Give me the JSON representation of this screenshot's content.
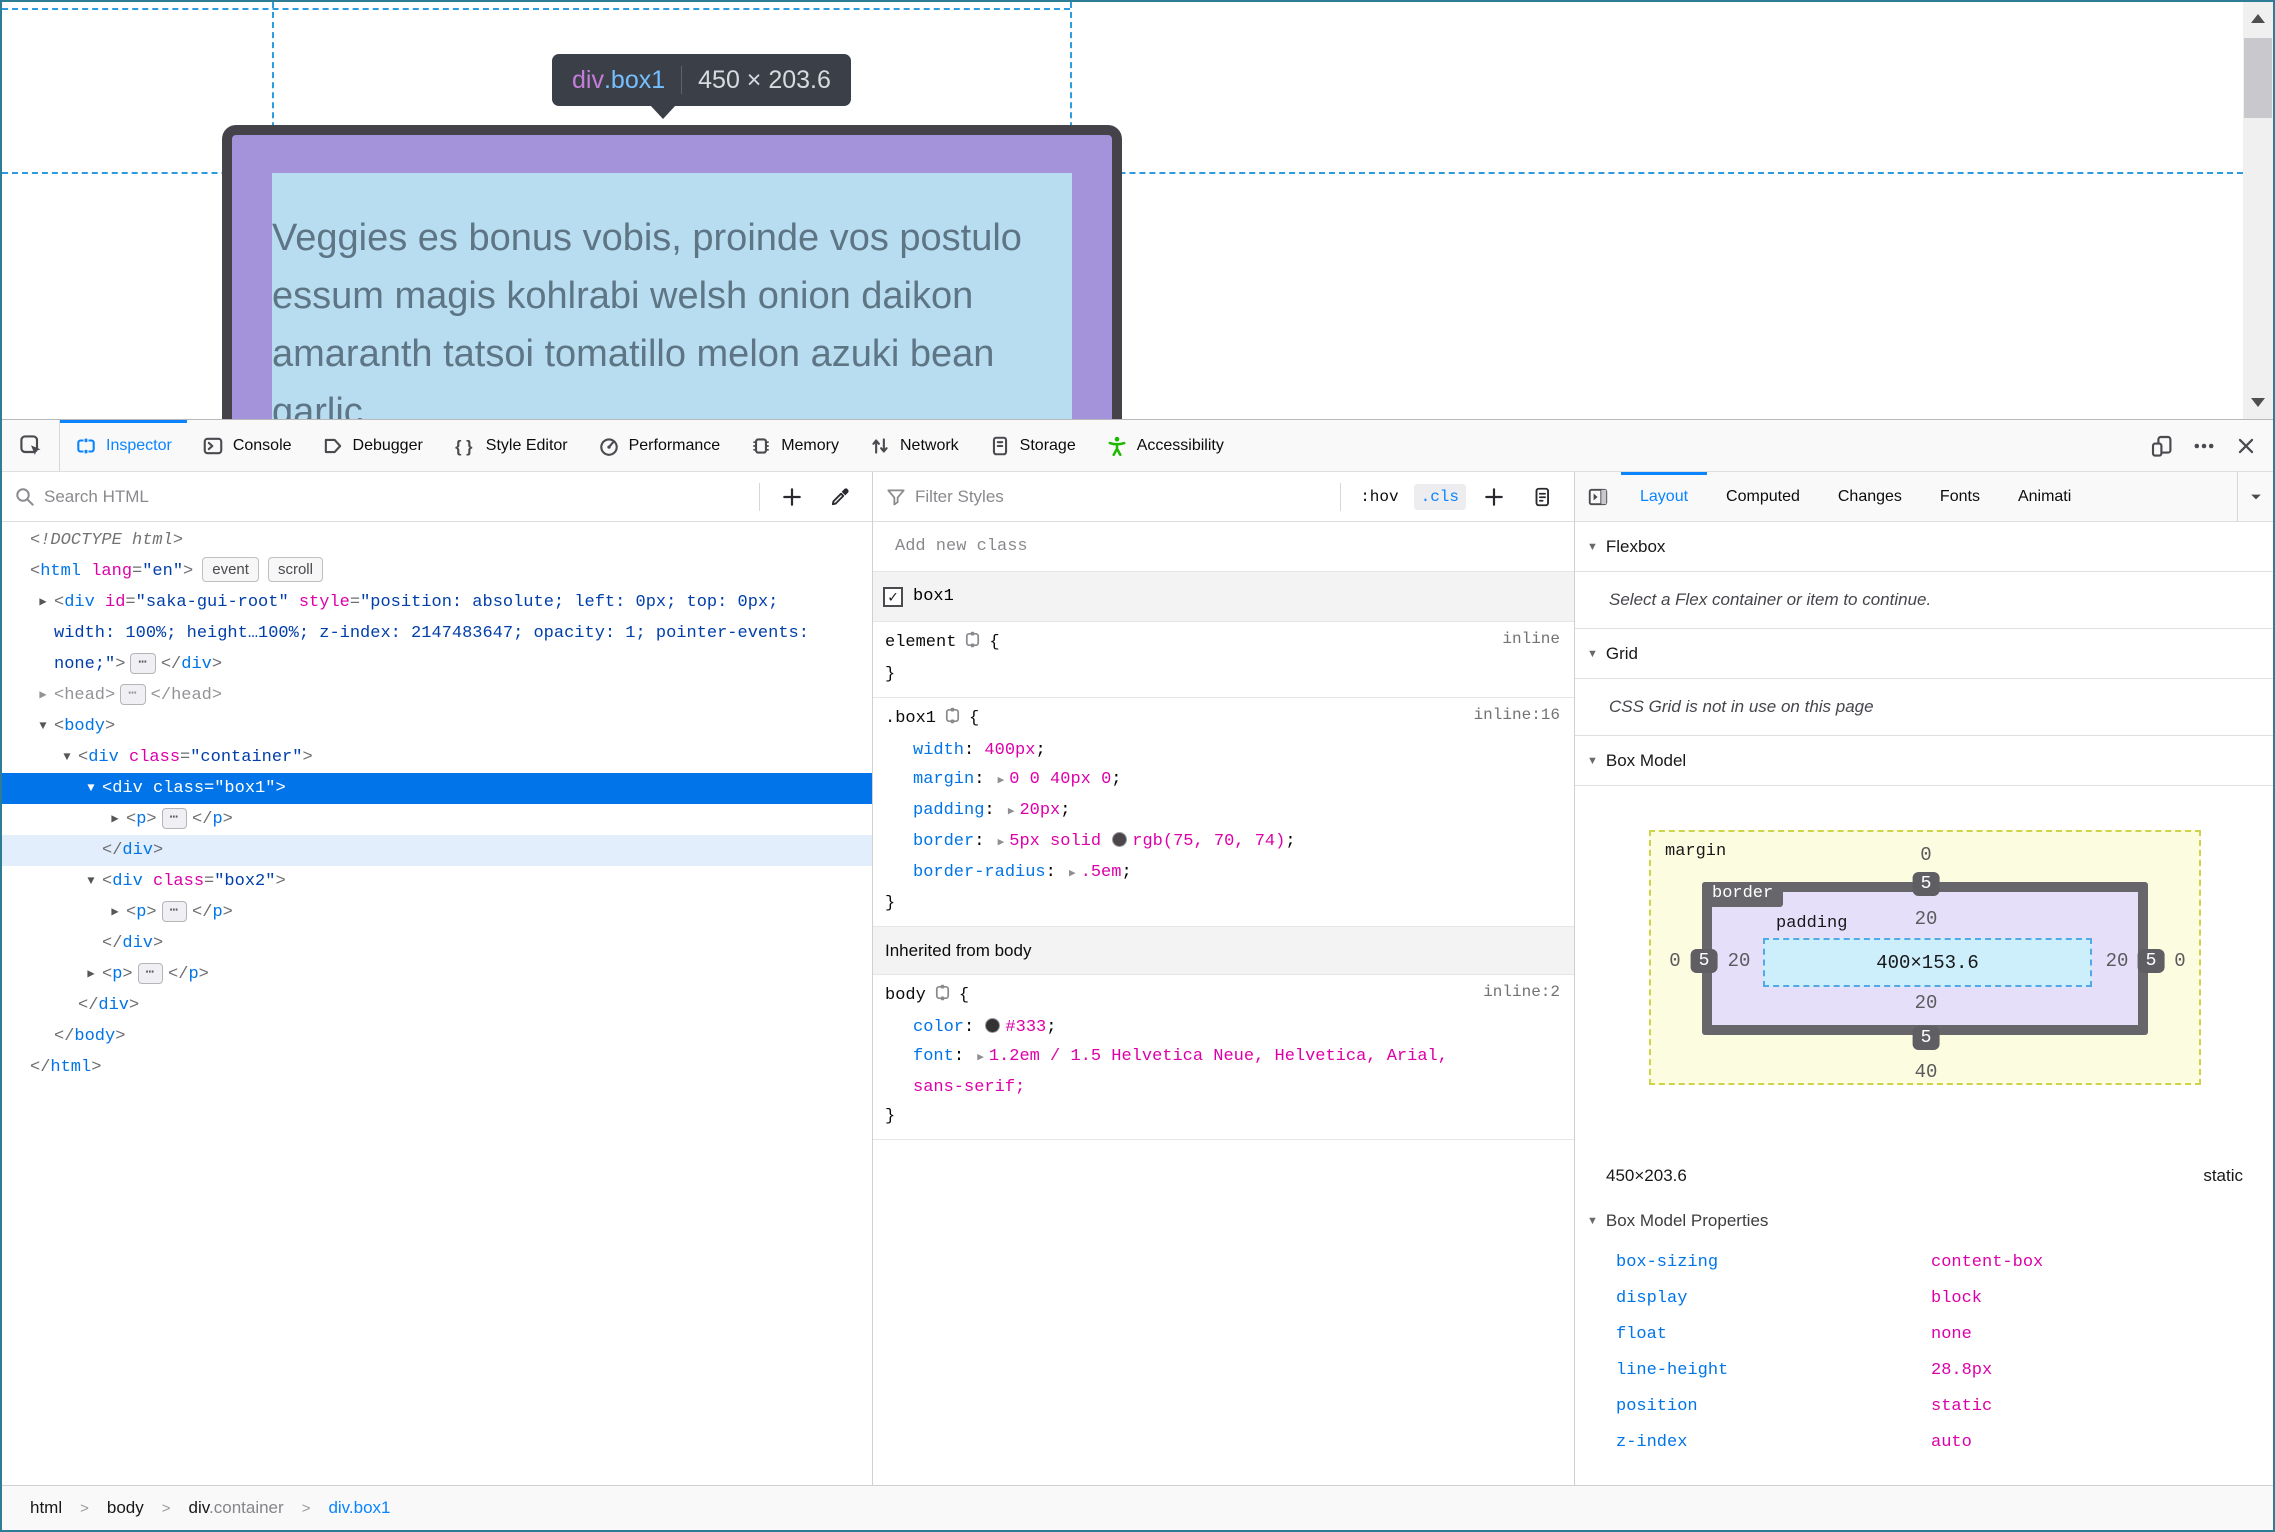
{
  "colors": {
    "accent": "#0a84ff",
    "tag_blue": "#0074e8",
    "attr_magenta": "#dd00a9",
    "value_navy": "#003eaa",
    "selection": "#0074e8",
    "a11y_green": "#1cb900",
    "border_swatch": "#4a464a",
    "color_swatch": "#333333"
  },
  "page": {
    "tooltip": {
      "tag": "div",
      "class": ".box1",
      "dims": "450 × 203.6"
    },
    "content_text": "Veggies es bonus vobis, proinde vos postulo essum magis kohlrabi welsh onion daikon amaranth tatsoi tomatillo melon azuki bean garlic"
  },
  "toolbox": {
    "tabs": [
      {
        "id": "inspector",
        "label": "Inspector",
        "icon": "inspector-icon",
        "active": true
      },
      {
        "id": "console",
        "label": "Console",
        "icon": "console-icon"
      },
      {
        "id": "debugger",
        "label": "Debugger",
        "icon": "debugger-icon"
      },
      {
        "id": "styleeditor",
        "label": "Style Editor",
        "icon": "style-editor-icon"
      },
      {
        "id": "performance",
        "label": "Performance",
        "icon": "performance-icon"
      },
      {
        "id": "memory",
        "label": "Memory",
        "icon": "memory-icon"
      },
      {
        "id": "network",
        "label": "Network",
        "icon": "network-icon"
      },
      {
        "id": "storage",
        "label": "Storage",
        "icon": "storage-icon"
      },
      {
        "id": "accessibility",
        "label": "Accessibility",
        "icon": "accessibility-icon"
      }
    ]
  },
  "markup": {
    "search_placeholder": "Search HTML",
    "lines": [
      {
        "ind": 0,
        "tokens": [
          [
            "doctype",
            "<!DOCTYPE html>"
          ]
        ]
      },
      {
        "ind": 0,
        "tokens": [
          [
            "p",
            "<"
          ],
          [
            "t",
            "html"
          ],
          [
            "a",
            " lang"
          ],
          [
            "p",
            "="
          ],
          [
            "v",
            "\"en\""
          ],
          [
            "p",
            ">"
          ]
        ],
        "badges": [
          "event",
          "scroll"
        ]
      },
      {
        "ind": 1,
        "arrow": "right",
        "wrap": true,
        "tokens": [
          [
            "p",
            "<"
          ],
          [
            "t",
            "div"
          ],
          [
            "a",
            " id"
          ],
          [
            "p",
            "="
          ],
          [
            "v",
            "\"saka-gui-root\""
          ],
          [
            "a",
            " style"
          ],
          [
            "p",
            "="
          ],
          [
            "v",
            "\"position: absolute; left: 0px; top: 0px; width: 100%; height…100%; z-index: 2147483647; opacity: 1; pointer-events: none;\""
          ],
          [
            "p",
            ">"
          ],
          [
            "e",
            ""
          ],
          [
            "p",
            "</"
          ],
          [
            "t",
            "div"
          ],
          [
            "p",
            ">"
          ]
        ]
      },
      {
        "ind": 1,
        "arrow": "right",
        "cls": "dim",
        "tokens": [
          [
            "p",
            "<"
          ],
          [
            "t",
            "head"
          ],
          [
            "p",
            ">"
          ],
          [
            "e",
            ""
          ],
          [
            "p",
            "</"
          ],
          [
            "t",
            "head"
          ],
          [
            "p",
            ">"
          ]
        ]
      },
      {
        "ind": 1,
        "arrow": "down",
        "tokens": [
          [
            "p",
            "<"
          ],
          [
            "t",
            "body"
          ],
          [
            "p",
            ">"
          ]
        ]
      },
      {
        "ind": 2,
        "arrow": "down",
        "tokens": [
          [
            "p",
            "<"
          ],
          [
            "t",
            "div"
          ],
          [
            "a",
            " class"
          ],
          [
            "p",
            "="
          ],
          [
            "v",
            "\"container\""
          ],
          [
            "p",
            ">"
          ]
        ]
      },
      {
        "ind": 3,
        "arrow": "down",
        "cls": "sel",
        "tokens": [
          [
            "p",
            "<"
          ],
          [
            "t",
            "div"
          ],
          [
            "a",
            " class"
          ],
          [
            "p",
            "="
          ],
          [
            "v",
            "\"box1\""
          ],
          [
            "p",
            ">"
          ]
        ]
      },
      {
        "ind": 4,
        "arrow": "right",
        "tokens": [
          [
            "p",
            "<"
          ],
          [
            "t",
            "p"
          ],
          [
            "p",
            ">"
          ],
          [
            "e",
            ""
          ],
          [
            "p",
            "</"
          ],
          [
            "t",
            "p"
          ],
          [
            "p",
            ">"
          ]
        ]
      },
      {
        "ind": 3,
        "cls": "tint",
        "tokens": [
          [
            "p",
            "</"
          ],
          [
            "t",
            "div"
          ],
          [
            "p",
            ">"
          ]
        ]
      },
      {
        "ind": 3,
        "arrow": "down",
        "tokens": [
          [
            "p",
            "<"
          ],
          [
            "t",
            "div"
          ],
          [
            "a",
            " class"
          ],
          [
            "p",
            "="
          ],
          [
            "v",
            "\"box2\""
          ],
          [
            "p",
            ">"
          ]
        ]
      },
      {
        "ind": 4,
        "arrow": "right",
        "tokens": [
          [
            "p",
            "<"
          ],
          [
            "t",
            "p"
          ],
          [
            "p",
            ">"
          ],
          [
            "e",
            ""
          ],
          [
            "p",
            "</"
          ],
          [
            "t",
            "p"
          ],
          [
            "p",
            ">"
          ]
        ]
      },
      {
        "ind": 3,
        "tokens": [
          [
            "p",
            "</"
          ],
          [
            "t",
            "div"
          ],
          [
            "p",
            ">"
          ]
        ]
      },
      {
        "ind": 3,
        "arrow": "right",
        "tokens": [
          [
            "p",
            "<"
          ],
          [
            "t",
            "p"
          ],
          [
            "p",
            ">"
          ],
          [
            "e",
            ""
          ],
          [
            "p",
            "</"
          ],
          [
            "t",
            "p"
          ],
          [
            "p",
            ">"
          ]
        ]
      },
      {
        "ind": 2,
        "tokens": [
          [
            "p",
            "</"
          ],
          [
            "t",
            "div"
          ],
          [
            "p",
            ">"
          ]
        ]
      },
      {
        "ind": 1,
        "tokens": [
          [
            "p",
            "</"
          ],
          [
            "t",
            "body"
          ],
          [
            "p",
            ">"
          ]
        ]
      },
      {
        "ind": 0,
        "tokens": [
          [
            "p",
            "</"
          ],
          [
            "t",
            "html"
          ],
          [
            "p",
            ">"
          ]
        ]
      }
    ]
  },
  "rules": {
    "filter_placeholder": "Filter Styles",
    "pseudo_hover": ":hov",
    "pseudo_class": ".cls",
    "add_class_placeholder": "Add new class",
    "class_toggle_label": "box1",
    "element_rule": {
      "selector": "element",
      "link": "inline"
    },
    "box1_rule": {
      "selector": ".box1",
      "link": "inline:16",
      "decls": [
        {
          "n": "width",
          "v": [
            [
              "t",
              "400px"
            ]
          ]
        },
        {
          "n": "margin",
          "v": [
            [
              "x",
              ""
            ],
            [
              "t",
              "0 0 40px 0"
            ]
          ]
        },
        {
          "n": "padding",
          "v": [
            [
              "x",
              ""
            ],
            [
              "t",
              "20px"
            ]
          ]
        },
        {
          "n": "border",
          "v": [
            [
              "x",
              ""
            ],
            [
              "t",
              "5px solid "
            ],
            [
              "sw",
              "#4a464a"
            ],
            [
              "t",
              "rgb(75, 70, 74)"
            ]
          ]
        },
        {
          "n": "border-radius",
          "v": [
            [
              "x",
              ""
            ],
            [
              "t",
              ".5em"
            ]
          ]
        }
      ]
    },
    "inherited_label": "Inherited from body",
    "body_rule": {
      "selector": "body",
      "link": "inline:2",
      "decls": [
        {
          "n": "color",
          "v": [
            [
              "sw",
              "#333333"
            ],
            [
              "t",
              "#333"
            ]
          ]
        },
        {
          "n": "font",
          "v": [
            [
              "x",
              ""
            ],
            [
              "t",
              "1.2em / 1.5 Helvetica Neue, Helvetica, Arial,"
            ]
          ],
          "wrap2": "sans-serif;"
        }
      ]
    }
  },
  "layout": {
    "tabs": [
      {
        "label": "Layout",
        "active": true
      },
      {
        "label": "Computed"
      },
      {
        "label": "Changes"
      },
      {
        "label": "Fonts"
      },
      {
        "label": "Animati"
      }
    ],
    "flexbox": {
      "title": "Flexbox",
      "message": "Select a Flex container or item to continue."
    },
    "grid": {
      "title": "Grid",
      "message": "CSS Grid is not in use on this page"
    },
    "boxmodel": {
      "title": "Box Model",
      "margin_label": "margin",
      "border_label": "border",
      "padding_label": "padding",
      "content": "400×153.6",
      "margin": {
        "top": "0",
        "right": "0",
        "bottom": "40",
        "left": "0"
      },
      "border": {
        "top": "5",
        "right": "5",
        "bottom": "5",
        "left": "5"
      },
      "padding": {
        "top": "20",
        "right": "20",
        "bottom": "20",
        "left": "20"
      },
      "dims": "450×203.6",
      "position": "static",
      "props_title": "Box Model Properties",
      "props": [
        {
          "name": "box-sizing",
          "value": "content-box"
        },
        {
          "name": "display",
          "value": "block"
        },
        {
          "name": "float",
          "value": "none"
        },
        {
          "name": "line-height",
          "value": "28.8px"
        },
        {
          "name": "position",
          "value": "static"
        },
        {
          "name": "z-index",
          "value": "auto"
        }
      ]
    }
  },
  "breadcrumb": [
    {
      "main": "html"
    },
    {
      "main": "body"
    },
    {
      "main": "div",
      "sub": ".container"
    },
    {
      "main": "div.box1",
      "selected": true
    }
  ]
}
